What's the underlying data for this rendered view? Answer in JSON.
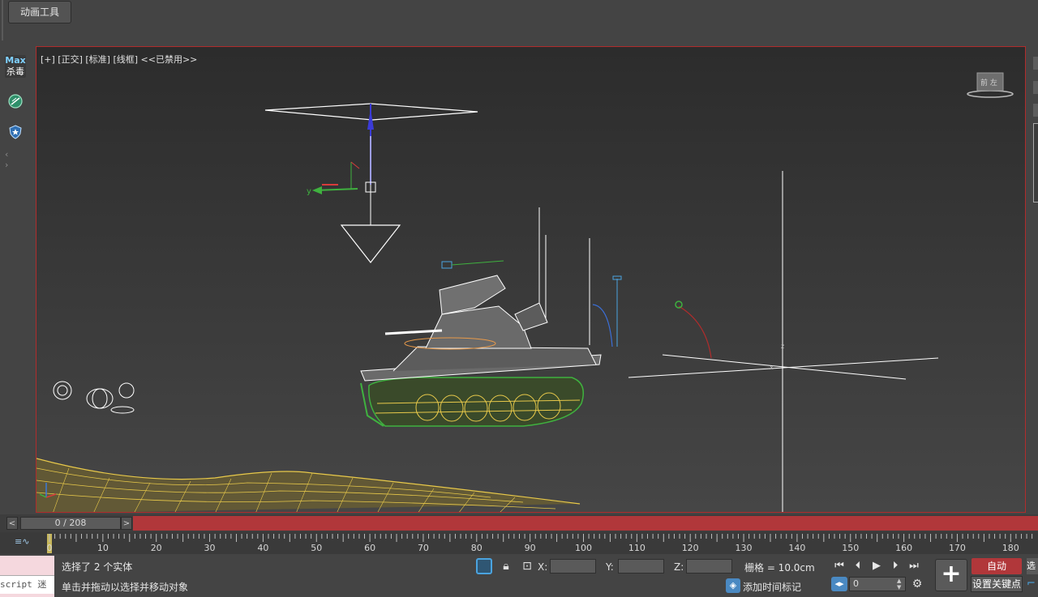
{
  "menu": {
    "animation_tools": "动画工具"
  },
  "side_toolbar": {
    "logo_top": "Max",
    "logo_bottom": "杀毒",
    "nav": "‹ ›"
  },
  "viewport": {
    "label": "[+] [正交] [标准] [线框] <<已禁用>>",
    "viewcube_label": "前 左",
    "axis_y": "y",
    "axis_x": "x",
    "axis_z": "z"
  },
  "timeline": {
    "slider_text": "0 / 208",
    "current_frame": 0,
    "total_frames": 208,
    "ticks": [
      "0",
      "10",
      "20",
      "30",
      "40",
      "50",
      "60",
      "70",
      "80",
      "90",
      "100",
      "110",
      "120",
      "130",
      "140",
      "150",
      "160",
      "170",
      "180"
    ]
  },
  "status": {
    "selection": "选择了 2 个实体",
    "prompt": "单击并拖动以选择并移动对象",
    "maxscript": "script 迷",
    "x_label": "X:",
    "y_label": "Y:",
    "z_label": "Z:",
    "x_value": "",
    "y_value": "",
    "z_value": "",
    "grid": "栅格 = 10.0cm",
    "add_time_tag": "添加时间标记"
  },
  "playback": {
    "frame_value": "0",
    "auto_key": "自动",
    "set_key": "设置关键点",
    "select_trunc": "选",
    "go_start": "⏮",
    "prev_frame": "⏴",
    "play": "▶",
    "next_frame": "⏵",
    "go_end": "⏭"
  },
  "colors": {
    "active_border": "#b02c2c",
    "auto_key_bg": "#b1373a",
    "accent_blue": "#4a89c2",
    "wire_yellow": "#e8c94a",
    "wire_green": "#3fb13f"
  },
  "icons": [
    "max-antivirus-icon",
    "circle-slash-icon",
    "shield-icon",
    "lock-icon",
    "absolute-mode-icon",
    "play-icon",
    "time-config-icon",
    "key-filter-icon",
    "curve-editor-icon"
  ]
}
